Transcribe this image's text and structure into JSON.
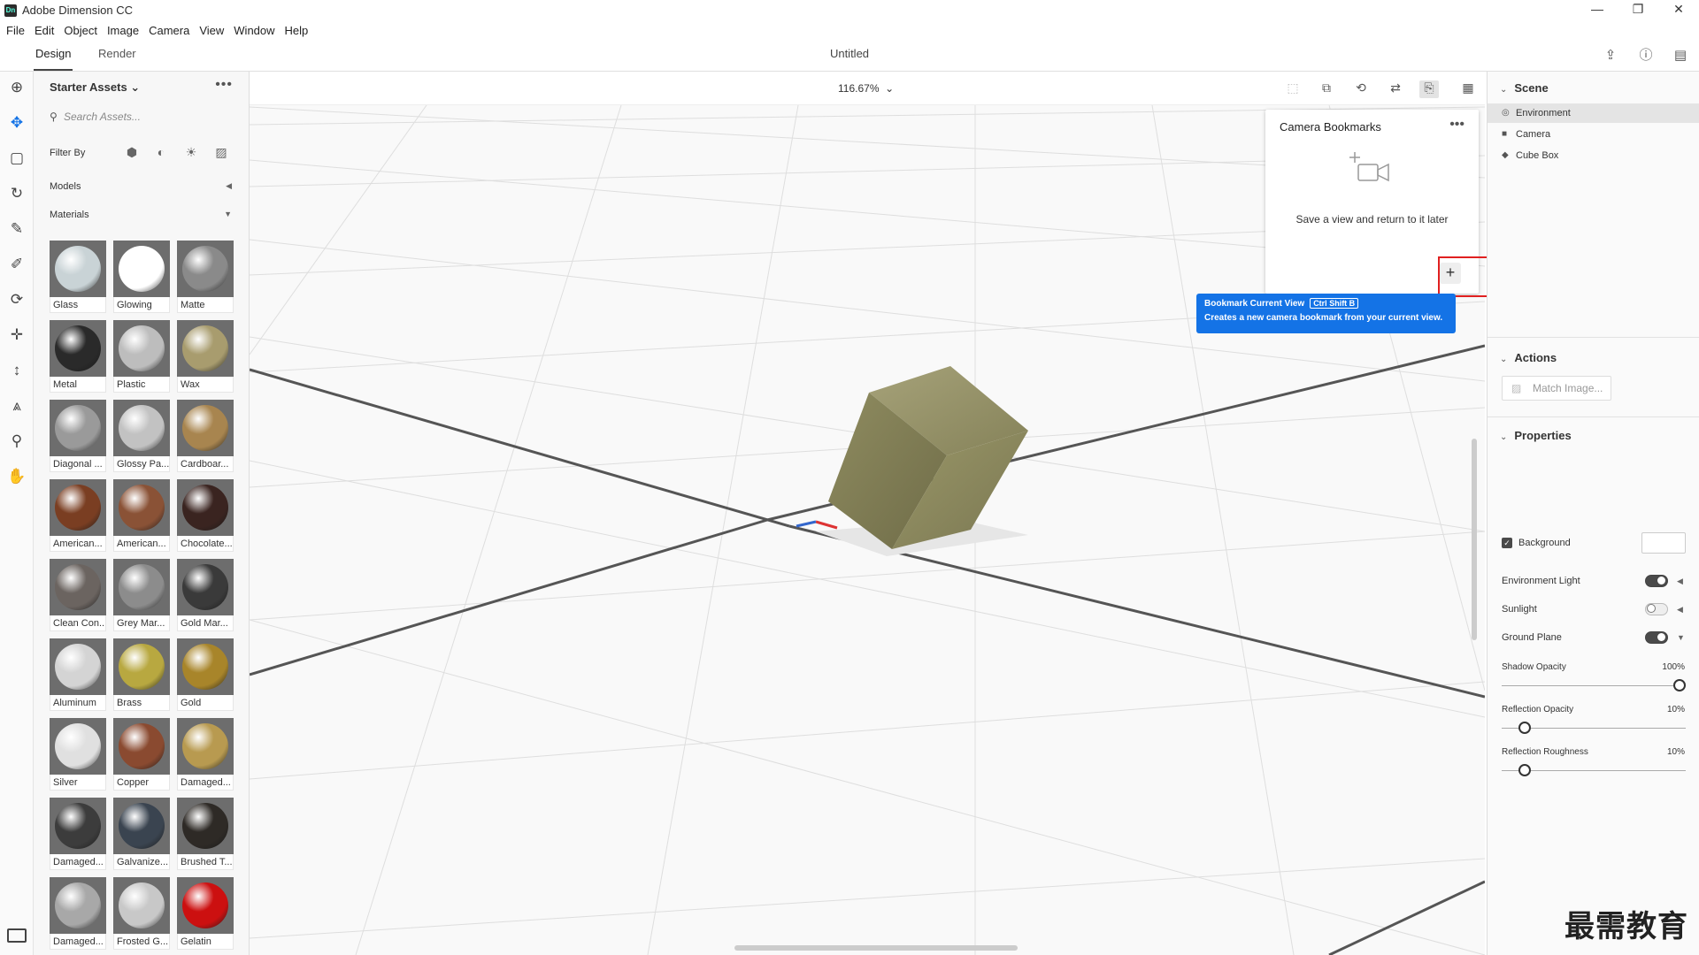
{
  "app": {
    "title": "Adobe Dimension CC",
    "logo": "Dn",
    "doc_title": "Untitled"
  },
  "window_controls": {
    "minimize": "—",
    "restore": "❐",
    "close": "✕"
  },
  "menu": [
    "File",
    "Edit",
    "Object",
    "Image",
    "Camera",
    "View",
    "Window",
    "Help"
  ],
  "modes": {
    "design": "Design",
    "render": "Render"
  },
  "assets": {
    "title": "Starter Assets",
    "more": "•••",
    "search_placeholder": "Search Assets...",
    "filter_label": "Filter By",
    "models_label": "Models",
    "materials_label": "Materials",
    "materials": [
      {
        "name": "Glass",
        "color": "#c9d3d6"
      },
      {
        "name": "Glowing",
        "color": "#ffffff"
      },
      {
        "name": "Matte",
        "color": "#8a8a8a"
      },
      {
        "name": "Metal",
        "color": "#2a2a2a"
      },
      {
        "name": "Plastic",
        "color": "#bdbdbd"
      },
      {
        "name": "Wax",
        "color": "#a89c6e"
      },
      {
        "name": "Diagonal ...",
        "color": "#9a9a9a"
      },
      {
        "name": "Glossy Pa...",
        "color": "#c2c2c2"
      },
      {
        "name": "Cardboar...",
        "color": "#a8854f"
      },
      {
        "name": "American...",
        "color": "#7a3e22"
      },
      {
        "name": "American...",
        "color": "#8a5236"
      },
      {
        "name": "Chocolate...",
        "color": "#3a2420"
      },
      {
        "name": "Clean Con...",
        "color": "#6b6460"
      },
      {
        "name": "Grey Mar...",
        "color": "#8c8c8c"
      },
      {
        "name": "Gold Mar...",
        "color": "#3a3a3a"
      },
      {
        "name": "Aluminum",
        "color": "#d4d4d4"
      },
      {
        "name": "Brass",
        "color": "#b8a840"
      },
      {
        "name": "Gold",
        "color": "#a8852a"
      },
      {
        "name": "Silver",
        "color": "#e0e0e0"
      },
      {
        "name": "Copper",
        "color": "#8a4a30"
      },
      {
        "name": "Damaged...",
        "color": "#b89a50"
      },
      {
        "name": "Damaged...",
        "color": "#3c3c3c"
      },
      {
        "name": "Galvanize...",
        "color": "#3a4450"
      },
      {
        "name": "Brushed T...",
        "color": "#2e2a26"
      },
      {
        "name": "Damaged...",
        "color": "#a8a8a8"
      },
      {
        "name": "Frosted G...",
        "color": "#c8c8c8"
      },
      {
        "name": "Gelatin",
        "color": "#cc1010"
      }
    ]
  },
  "viewport": {
    "zoom": "116.67%"
  },
  "bookmarks": {
    "title": "Camera Bookmarks",
    "more": "•••",
    "empty_message": "Save a view and return to it later",
    "add_label": "+",
    "tooltip_title": "Bookmark Current View",
    "tooltip_shortcut": "Ctrl Shift B",
    "tooltip_desc": "Creates a new camera bookmark from your current view."
  },
  "scene": {
    "title": "Scene",
    "items": [
      {
        "label": "Environment",
        "icon": "environment-icon",
        "selected": true
      },
      {
        "label": "Camera",
        "icon": "camera-icon",
        "selected": false
      },
      {
        "label": "Cube Box",
        "icon": "model-icon",
        "selected": false
      }
    ]
  },
  "actions": {
    "title": "Actions",
    "match_image": "Match Image..."
  },
  "properties": {
    "title": "Properties",
    "background": "Background",
    "environment_light": "Environment Light",
    "sunlight": "Sunlight",
    "ground_plane": "Ground Plane",
    "shadow_opacity": {
      "label": "Shadow Opacity",
      "value": "100%",
      "fraction": 1.0
    },
    "reflection_opacity": {
      "label": "Reflection Opacity",
      "value": "10%",
      "fraction": 0.1
    },
    "reflection_roughness": {
      "label": "Reflection Roughness",
      "value": "10%",
      "fraction": 0.1
    }
  },
  "watermark": "最需教育",
  "colors": {
    "accent": "#1473e6",
    "highlight": "#e02020",
    "cube": "#8f8c5e"
  }
}
